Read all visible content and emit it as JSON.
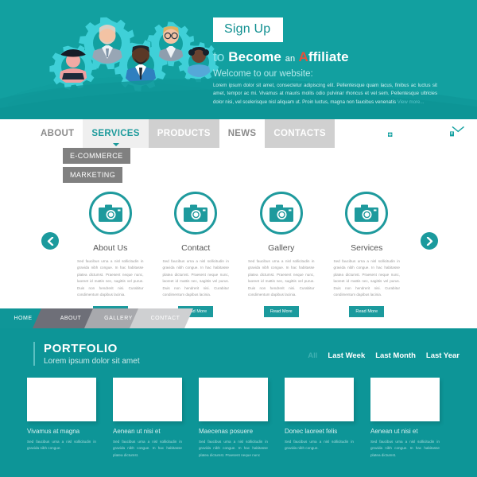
{
  "hero": {
    "signup_label": "Sign Up",
    "headline_lead": "to",
    "headline_mid": "Become",
    "headline_small": "an",
    "headline_accent": "A",
    "headline_rest": "ffiliate",
    "welcome": "Welcome to our website:",
    "body": "Lorem ipsum dolor sit amet, consectetur adipiscing elit. Pellentesque quam lacus, finibus ac luctus sit amet, tempor ac mi. Vivamus at mauris mollis odio pulvinar rhoncus et vel sem. Pellentesque ultricies dolor nisi, vel scelerisque nisl aliquam ut. Proin luctus, magna non faucibus venenatis",
    "view_more": "View more..."
  },
  "nav": {
    "items": [
      {
        "label": "ABOUT",
        "style": "n-white"
      },
      {
        "label": "SERVICES",
        "style": "n-active"
      },
      {
        "label": "PRODUCTS",
        "style": "n-grey"
      },
      {
        "label": "NEWS",
        "style": "n-white"
      },
      {
        "label": "CONTACTS",
        "style": "n-grey"
      }
    ],
    "submenu": [
      "E-COMMERCE",
      "MARKETING"
    ],
    "icons": [
      "heart-plus-icon",
      "search-icon",
      "mail-icon"
    ]
  },
  "cards": {
    "prev_label": "previous-slide",
    "next_label": "next-slide",
    "items": [
      {
        "title": "About Us",
        "body": "Sed faucibus urna a nisl sollicitudin in gravida nibh congue. In hac habitasse platea dictumst. Praesent neque nunc, laoreet id mattis nec, sagittis vel purus. Duis non hendrerit nisi. Curabitur condimentum dapibus lacinia.",
        "button": "Read More"
      },
      {
        "title": "Contact",
        "body": "Sed faucibus urna a nisl sollicitudin in gravida nibh congue. In hac habitasse platea dictumst. Praesent neque nunc, laoreet id mattis nec, sagittis vel purus. Duis non hendrerit nisi. Curabitur condimentum dapibus lacinia.",
        "button": "Read More"
      },
      {
        "title": "Gallery",
        "body": "Sed faucibus urna a nisl sollicitudin in gravida nibh congue. In hac habitasse platea dictumst. Praesent neque nunc, laoreet id mattis nec, sagittis vel purus. Duis non hendrerit nisi. Curabitur condimentum dapibus lacinia.",
        "button": "Read More"
      },
      {
        "title": "Services",
        "body": "Sed faucibus urna a nisl sollicitudin in gravida nibh congue. In hac habitasse platea dictumst. Praesent neque nunc, laoreet id mattis nec, sagittis vel purus. Duis non hendrerit nisi. Curabitur condimentum dapibus lacinia.",
        "button": "Read More"
      }
    ]
  },
  "breadcrumb": [
    {
      "label": "HOME",
      "color": "#0f9698"
    },
    {
      "label": "ABOUT",
      "color": "#6e6f78"
    },
    {
      "label": "GALLERY",
      "color": "#a8a9ad"
    },
    {
      "label": "CONTACT",
      "color": "#cfd0d2"
    }
  ],
  "portfolio": {
    "title": "PORTFOLIO",
    "subtitle": "Lorem ipsum dolor sit amet",
    "filters": [
      {
        "label": "All",
        "active": true
      },
      {
        "label": "Last Week",
        "active": false
      },
      {
        "label": "Last Month",
        "active": false
      },
      {
        "label": "Last Year",
        "active": false
      }
    ],
    "items": [
      {
        "name": "Vivamus at magna",
        "desc": "Sed faucibus urna a nisl sollicitudin in gravida nibh congue."
      },
      {
        "name": "Aenean ut nisi et",
        "desc": "Sed faucibus urna a nisl sollicitudin in gravida nibh congue. In hac habitasse platea dictumst."
      },
      {
        "name": "Maecenas posuere",
        "desc": "Sed faucibus urna a nisl sollicitudin in gravida nibh congue. In hac habitasse platea dictumst. Praesent neque nunc"
      },
      {
        "name": "Donec laoreet felis",
        "desc": "Sed faucibus urna a nisl sollicitudin in gravida nibh congue."
      },
      {
        "name": "Aenean ut nisi et",
        "desc": "Sed faucibus urna a nisl sollicitudin in gravida nibh congue. In hac habitasse platea dictumst."
      }
    ]
  },
  "colors": {
    "teal": "#12a0a0",
    "teal_dark": "#0d9597",
    "accent_red": "#e8503a",
    "cyan_light": "#4ed6dd"
  }
}
